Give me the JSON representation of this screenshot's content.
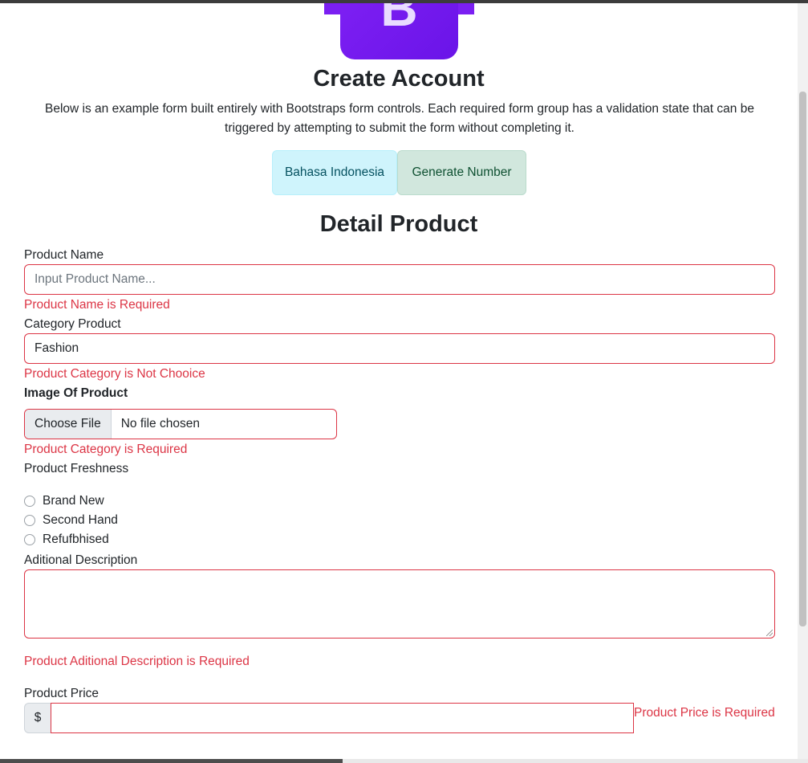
{
  "header": {
    "logo_letter": "B",
    "title": "Create Account",
    "intro": "Below is an example form built entirely with Bootstraps form controls. Each required form group has a validation state that can be triggered by attempting to submit the form without completing it."
  },
  "actions": {
    "language_button": "Bahasa Indonesia",
    "generate_button": "Generate Number"
  },
  "form": {
    "section_title": "Detail Product",
    "product_name": {
      "label": "Product Name",
      "placeholder": "Input Product Name...",
      "value": "",
      "error": "Product Name is Required"
    },
    "category": {
      "label": "Category Product",
      "selected": "Fashion",
      "error": "Product Category is Not Chooice"
    },
    "image": {
      "label": "Image Of Product",
      "button": "Choose File",
      "status": "No file chosen",
      "error": "Product Category is Required"
    },
    "freshness": {
      "label": "Product Freshness",
      "options": [
        "Brand New",
        "Second Hand",
        "Refufbhised"
      ]
    },
    "description": {
      "label": "Aditional Description",
      "value": "",
      "error": "Product Aditional Description is Required"
    },
    "price": {
      "label": "Product Price",
      "prefix": "$",
      "value": "",
      "error": "Product Price is Required"
    }
  },
  "colors": {
    "error": "#dc3545",
    "logo": "#7b1ff2",
    "info_bg": "#cff4fc",
    "success_bg": "#d1e7dd"
  }
}
